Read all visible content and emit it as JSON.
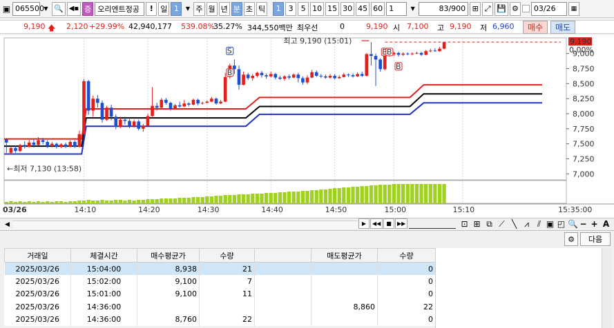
{
  "toolbar": {
    "code": "065500",
    "name_badge": "증",
    "stock_name": "오리엔트정공",
    "exclaim": "!",
    "period_day": "일",
    "period_sel": "1",
    "period_week": "주",
    "period_month": "월",
    "period_year": "년",
    "period_min": "분",
    "period_sec": "초",
    "period_tick": "틱",
    "intervals": [
      "1",
      "3",
      "5",
      "10",
      "15",
      "30",
      "45",
      "60"
    ],
    "interval_sel": "1",
    "count": "83",
    "count_total": "/900",
    "date": "03/26"
  },
  "quote": {
    "price": "9,190",
    "change": "2,120",
    "change_pct": "+29.99%",
    "volume": "42,940,177",
    "vol_ratio": "539.08%",
    "turnover": "35.27%",
    "amount": "344,550백만",
    "best_ask_label": "최우선",
    "best_ask_val": "0",
    "price2": "9,190",
    "open_label": "시",
    "open": "7,100",
    "high_label": "고",
    "high": "9,190",
    "low_label": "저",
    "low": "6,960",
    "buy_label": "매수",
    "sell_label": "매도"
  },
  "chart_data": {
    "type": "candlestick",
    "x_ticks": [
      "03/26",
      "14:10",
      "14:20",
      "14:30",
      "14:40",
      "14:50",
      "15:00",
      "15:10",
      "15:35:00"
    ],
    "y_ticks": [
      "7,000",
      "7,250",
      "7,500",
      "7,750",
      "8,000",
      "8,250",
      "8,500",
      "8,750",
      "9,000"
    ],
    "y_last": "9,190",
    "y_pct": "0.00%",
    "ylim": [
      6900,
      9260
    ],
    "high_note": "최고 9,190 (15:01)",
    "low_note": "최저 7,130 (13:58)",
    "signal_s": "S",
    "signal_b": "B",
    "candles": [
      [
        7570,
        7520,
        7590,
        7350
      ],
      [
        7350,
        7430,
        7460,
        7330
      ],
      [
        7430,
        7380,
        7470,
        7350
      ],
      [
        7380,
        7480,
        7500,
        7360
      ],
      [
        7480,
        7450,
        7540,
        7420
      ],
      [
        7450,
        7520,
        7560,
        7440
      ],
      [
        7520,
        7480,
        7580,
        7440
      ],
      [
        7480,
        7560,
        7610,
        7470
      ],
      [
        7560,
        7530,
        7600,
        7490
      ],
      [
        7530,
        7460,
        7560,
        7430
      ],
      [
        7460,
        7500,
        7530,
        7440
      ],
      [
        7500,
        7450,
        7520,
        7420
      ],
      [
        7450,
        7490,
        7510,
        7430
      ],
      [
        7490,
        7450,
        7520,
        7430
      ],
      [
        7450,
        7530,
        7560,
        7440
      ],
      [
        7530,
        7450,
        7560,
        7430
      ],
      [
        7450,
        7660,
        7720,
        7440
      ],
      [
        7660,
        8540,
        8580,
        7640
      ],
      [
        8540,
        8050,
        8560,
        7980
      ],
      [
        8050,
        8250,
        8300,
        7950
      ],
      [
        8250,
        8180,
        8310,
        8100
      ],
      [
        8180,
        7900,
        8220,
        7850
      ],
      [
        7900,
        8100,
        8130,
        7880
      ],
      [
        8100,
        7950,
        8150,
        7890
      ],
      [
        7950,
        7780,
        7990,
        7740
      ],
      [
        7780,
        7900,
        7950,
        7760
      ],
      [
        7900,
        7880,
        7950,
        7820
      ],
      [
        7880,
        7790,
        7910,
        7760
      ],
      [
        7790,
        7870,
        7900,
        7770
      ],
      [
        7870,
        7750,
        7900,
        7720
      ],
      [
        7750,
        7800,
        7830,
        7700
      ],
      [
        7800,
        7960,
        8000,
        7790
      ],
      [
        7960,
        8130,
        8440,
        7950
      ],
      [
        8130,
        8100,
        8180,
        8050
      ],
      [
        8100,
        8230,
        8260,
        8080
      ],
      [
        8230,
        8180,
        8260,
        8150
      ],
      [
        8180,
        8080,
        8200,
        8050
      ],
      [
        8080,
        8140,
        8160,
        8070
      ],
      [
        8140,
        8120,
        8200,
        8100
      ],
      [
        8120,
        8170,
        8230,
        8110
      ],
      [
        8170,
        8150,
        8190,
        8120
      ],
      [
        8150,
        8230,
        8250,
        8140
      ],
      [
        8230,
        8170,
        8250,
        8140
      ],
      [
        8170,
        8180,
        8200,
        8150
      ],
      [
        8180,
        8200,
        8220,
        8170
      ],
      [
        8200,
        8250,
        8280,
        8190
      ],
      [
        8250,
        8170,
        8270,
        8150
      ],
      [
        8170,
        8200,
        8230,
        8160
      ],
      [
        8200,
        8610,
        8680,
        8190
      ],
      [
        8610,
        8800,
        8830,
        8580
      ],
      [
        8800,
        8740,
        8900,
        8660
      ],
      [
        8740,
        8480,
        8800,
        8400
      ],
      [
        8480,
        8650,
        8700,
        8470
      ],
      [
        8650,
        8590,
        8680,
        8560
      ],
      [
        8590,
        8630,
        8660,
        8550
      ],
      [
        8630,
        8680,
        8700,
        8600
      ],
      [
        8680,
        8640,
        8710,
        8600
      ],
      [
        8640,
        8620,
        8670,
        8580
      ],
      [
        8620,
        8660,
        8700,
        8600
      ],
      [
        8660,
        8600,
        8680,
        8570
      ],
      [
        8600,
        8580,
        8630,
        8560
      ],
      [
        8580,
        8620,
        8640,
        8550
      ],
      [
        8620,
        8600,
        8650,
        8570
      ],
      [
        8600,
        8650,
        8670,
        8590
      ],
      [
        8650,
        8590,
        8680,
        8520
      ],
      [
        8590,
        8520,
        8620,
        8480
      ],
      [
        8520,
        8600,
        8640,
        8490
      ],
      [
        8600,
        8690,
        8730,
        8590
      ],
      [
        8690,
        8630,
        8720,
        8610
      ],
      [
        8630,
        8620,
        8660,
        8590
      ],
      [
        8620,
        8600,
        8650,
        8580
      ],
      [
        8600,
        8630,
        8660,
        8580
      ],
      [
        8630,
        8590,
        8660,
        8570
      ],
      [
        8590,
        8610,
        8640,
        8580
      ],
      [
        8610,
        8650,
        8680,
        8600
      ],
      [
        8650,
        8640,
        8670,
        8610
      ],
      [
        8640,
        8620,
        8670,
        8600
      ],
      [
        8620,
        8660,
        8690,
        8610
      ],
      [
        8660,
        8630,
        8700,
        8610
      ],
      [
        8630,
        8990,
        9010,
        8620
      ],
      [
        8990,
        8960,
        9190,
        8800
      ],
      [
        8960,
        8900,
        9000,
        8460
      ],
      [
        8900,
        8740,
        8920,
        8700
      ]
    ],
    "candles_tail": [
      [
        8740,
        9010,
        9060,
        8720
      ],
      [
        9010,
        8990,
        9050,
        8950
      ],
      [
        8990,
        9010,
        9030,
        8960
      ],
      [
        9010,
        8980,
        9030,
        8950
      ],
      [
        8980,
        9000,
        9020,
        8960
      ],
      [
        9000,
        8990,
        9020,
        8970
      ],
      [
        8990,
        9000,
        9020,
        8970
      ],
      [
        9000,
        9010,
        9030,
        8990
      ],
      [
        9010,
        8980,
        9030,
        8960
      ],
      [
        8980,
        9040,
        9060,
        8970
      ],
      [
        9040,
        9050,
        9080,
        9020
      ],
      [
        9050,
        9040,
        9090,
        9030
      ],
      [
        9040,
        9080,
        9110,
        9030
      ],
      [
        9080,
        9190,
        9190,
        9070
      ]
    ],
    "upper_band": [
      [
        0,
        7580
      ],
      [
        17,
        7580
      ],
      [
        18,
        8080
      ],
      [
        53,
        8080
      ],
      [
        56,
        8270
      ],
      [
        89,
        8270
      ],
      [
        92,
        8480
      ],
      [
        118,
        8480
      ]
    ],
    "mid_band": [
      [
        0,
        7460
      ],
      [
        17,
        7460
      ],
      [
        18,
        7930
      ],
      [
        53,
        7930
      ],
      [
        56,
        8120
      ],
      [
        89,
        8120
      ],
      [
        92,
        8330
      ],
      [
        118,
        8330
      ]
    ],
    "lower_band": [
      [
        0,
        7330
      ],
      [
        17,
        7330
      ],
      [
        18,
        7790
      ],
      [
        53,
        7790
      ],
      [
        56,
        7990
      ],
      [
        89,
        7990
      ],
      [
        92,
        8180
      ],
      [
        118,
        8180
      ]
    ],
    "volume": [
      2,
      3,
      2,
      3,
      2,
      3,
      2,
      3,
      2,
      3,
      2,
      3,
      3,
      2,
      3,
      3,
      4,
      4,
      5,
      4,
      4,
      5,
      4,
      4,
      5,
      5,
      4,
      5,
      4,
      5,
      5,
      6,
      6,
      6,
      7,
      7,
      7,
      7,
      8,
      8,
      8,
      9,
      9,
      9,
      10,
      10,
      11,
      11,
      12,
      12,
      12,
      13,
      13,
      13,
      14,
      14,
      14,
      15,
      15,
      15,
      16,
      16,
      17,
      17,
      17,
      18,
      18,
      19,
      19,
      20,
      20,
      21,
      22,
      22,
      23,
      23,
      24,
      24,
      25,
      25,
      26,
      26,
      27,
      27,
      27,
      28,
      28,
      28,
      28,
      28,
      28,
      28,
      28,
      28,
      28,
      28,
      28,
      28,
      29,
      29,
      29,
      29,
      29,
      29,
      30,
      30,
      31,
      31,
      31,
      31,
      31,
      31,
      31,
      31,
      31,
      31,
      31,
      31
    ]
  },
  "grid": {
    "next_label": "다음",
    "headers": [
      "거래일",
      "체결시간",
      "매수평균가",
      "수량",
      "",
      "매도평균가",
      "수량"
    ],
    "rows": [
      [
        "2025/03/26",
        "15:04:00",
        "8,938",
        "21",
        "",
        "",
        "0"
      ],
      [
        "2025/03/26",
        "15:02:00",
        "9,100",
        "7",
        "",
        "",
        "0"
      ],
      [
        "2025/03/26",
        "15:01:00",
        "9,100",
        "11",
        "",
        "",
        "0"
      ],
      [
        "2025/03/26",
        "14:36:00",
        "",
        "",
        "",
        "8,860",
        "22"
      ],
      [
        "2025/03/26",
        "14:36:00",
        "8,760",
        "22",
        "",
        "",
        "0"
      ]
    ]
  }
}
